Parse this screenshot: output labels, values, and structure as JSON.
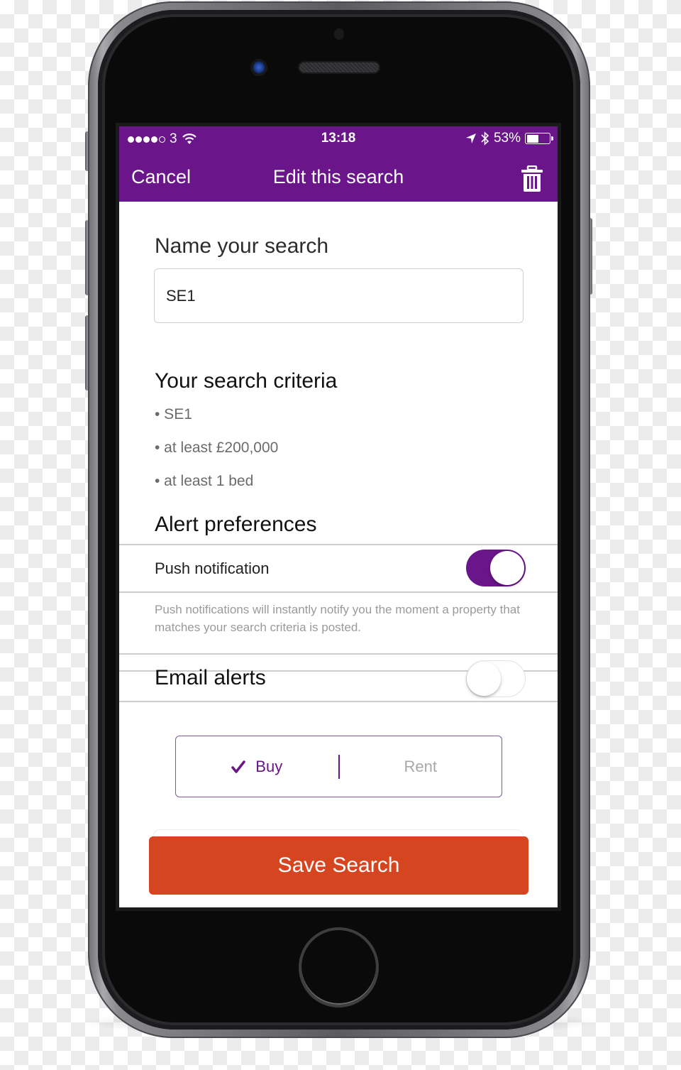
{
  "status_bar": {
    "carrier": "3",
    "signal_bars_filled": 4,
    "signal_bars_total": 5,
    "wifi_icon": "wifi-icon",
    "time": "13:18",
    "location_icon": "location-arrow-icon",
    "bluetooth_icon": "bluetooth-icon",
    "battery_percent_label": "53%",
    "battery_level": 0.53
  },
  "navbar": {
    "cancel_label": "Cancel",
    "title": "Edit this search",
    "delete_icon": "trash-icon"
  },
  "name_section": {
    "label": "Name your search",
    "input_value": "SE1"
  },
  "criteria": {
    "title": "Your search criteria",
    "items": [
      "• SE1",
      "• at least £200,000",
      "• at least 1 bed"
    ]
  },
  "alerts": {
    "title": "Alert preferences",
    "push": {
      "label": "Push notification",
      "enabled": true,
      "help": "Push notifications will instantly notify you the moment a property that matches your search criteria is posted."
    },
    "email": {
      "label": "Email alerts",
      "enabled": false
    }
  },
  "listing_type": {
    "options": [
      {
        "label": "Buy",
        "selected": true,
        "icon": "checkmark-icon"
      },
      {
        "label": "Rent",
        "selected": false
      }
    ]
  },
  "save_button": {
    "label": "Save Search"
  },
  "colors": {
    "brand_purple": "#6a1589",
    "save_orange": "#d54520",
    "help_text_gray": "#9a9a9a"
  }
}
